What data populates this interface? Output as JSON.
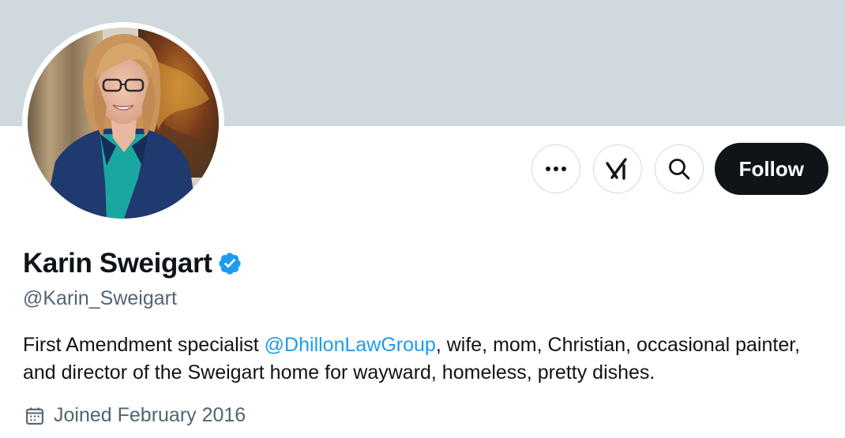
{
  "profile": {
    "display_name": "Karin Sweigart",
    "handle": "@Karin_Sweigart",
    "bio": {
      "before": "First Amendment specialist ",
      "mention": "@DhillonLawGroup",
      "after": ", wife, mom, Christian, occasional painter, and director of the Sweigart home for wayward, homeless, pretty dishes."
    },
    "joined": "Joined February 2016",
    "verified": true
  },
  "actions": {
    "more_icon": "more-icon",
    "grok_icon": "grok-icon",
    "search_icon": "search-icon",
    "follow_label": "Follow"
  },
  "colors": {
    "banner": "#cfd9de",
    "accent": "#1d9bf0",
    "text": "#0f1419",
    "secondary_text": "#536471",
    "follow_button": "#0f1419"
  }
}
